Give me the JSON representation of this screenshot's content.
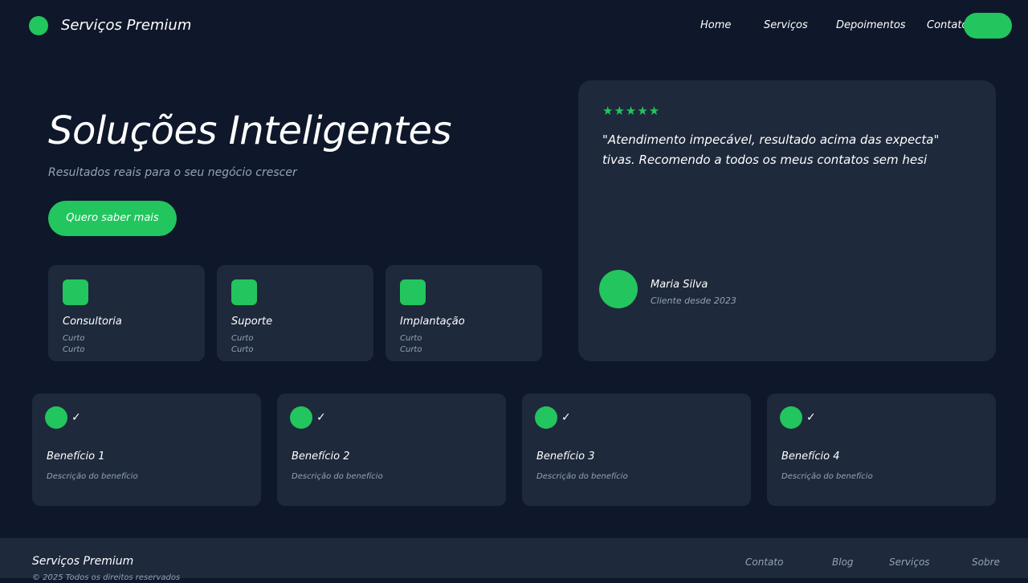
{
  "header": {
    "brand": "Serviços Premium",
    "nav": [
      "Home",
      "Serviços",
      "Depoimentos",
      "Contato"
    ]
  },
  "hero": {
    "title": "Soluções Inteligentes",
    "subtitle": "Resultados reais para o seu negócio crescer",
    "cta_label": "Quero saber mais"
  },
  "services": [
    {
      "title": "Consultoria",
      "desc_lines": [
        "Curto",
        "Curto"
      ],
      "icon": "square-icon"
    },
    {
      "title": "Suporte",
      "desc_lines": [
        "Curto",
        "Curto"
      ],
      "icon": "square-icon"
    },
    {
      "title": "Implantação",
      "desc_lines": [
        "Curto",
        "Curto"
      ],
      "icon": "square-icon"
    }
  ],
  "testimonial": {
    "stars": "★★★★★",
    "quote_lines": [
      "\"Atendimento impecável, resultado acima das expecta\"",
      "tivas. Recomendo a todos os meus contatos sem hesi"
    ],
    "author": "Maria Silva",
    "since": "Cliente desde 2023"
  },
  "benefits": [
    {
      "check": "✓",
      "title": "Benefício 1",
      "desc": "Descrição do benefício"
    },
    {
      "check": "✓",
      "title": "Benefício 2",
      "desc": "Descrição do benefício"
    },
    {
      "check": "✓",
      "title": "Benefício 3",
      "desc": "Descrição do benefício"
    },
    {
      "check": "✓",
      "title": "Benefício 4",
      "desc": "Descrição do benefício"
    }
  ],
  "footer": {
    "brand": "Serviços Premium",
    "copyright": "© 2025 Todos os direitos reservados",
    "links": [
      "Contato",
      "Blog",
      "Serviços",
      "Sobre"
    ]
  },
  "colors": {
    "background": "#0f172a",
    "card": "#1e293b",
    "accent": "#22c55e",
    "muted_text": "#94a3b8"
  }
}
